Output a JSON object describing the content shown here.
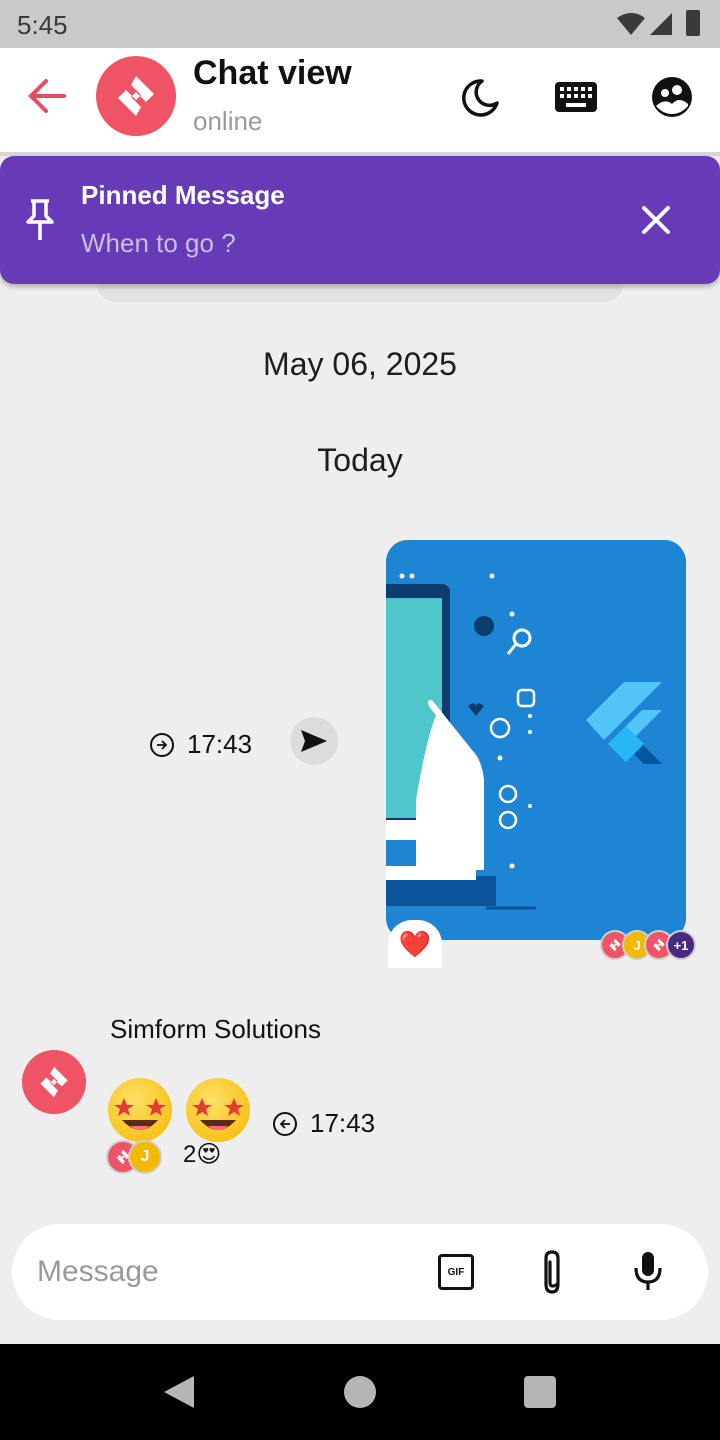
{
  "status_bar": {
    "time": "5:45"
  },
  "header": {
    "title": "Chat view",
    "subtitle": "online",
    "icons": [
      "back-arrow-icon",
      "moon-icon",
      "keyboard-icon",
      "group-icon"
    ]
  },
  "pinned": {
    "title": "Pinned Message",
    "text": "When to go ?"
  },
  "chat": {
    "date_separator": "May 06, 2025",
    "day_separator": "Today",
    "outgoing": {
      "time": "17:43",
      "reaction": "❤️",
      "extra_reactors": "+1",
      "reactor_initial": "J"
    },
    "incoming": {
      "sender": "Simform Solutions",
      "time": "17:43",
      "reactor_initial": "J",
      "reaction_count": "2😍"
    }
  },
  "composer": {
    "placeholder": "Message",
    "gif_label": "GIF"
  },
  "colors": {
    "accent": "#ee5366",
    "pinned_bg": "#673ab7",
    "image_bg": "#1e84d4"
  }
}
